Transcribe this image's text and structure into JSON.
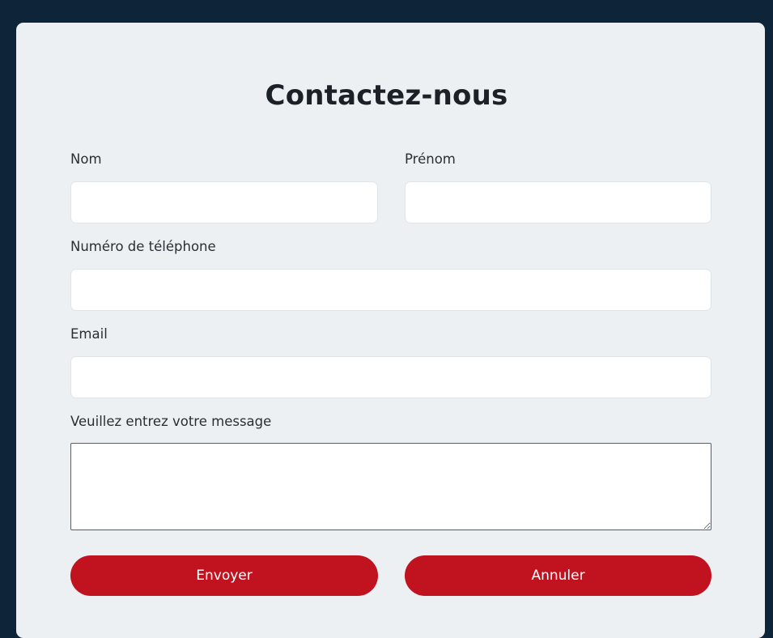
{
  "form": {
    "title": "Contactez-nous",
    "fields": {
      "nom": {
        "label": "Nom",
        "value": "",
        "placeholder": ""
      },
      "prenom": {
        "label": "Prénom",
        "value": "",
        "placeholder": ""
      },
      "telephone": {
        "label": "Numéro de téléphone",
        "value": "",
        "placeholder": ""
      },
      "email": {
        "label": "Email",
        "value": "",
        "placeholder": ""
      },
      "message": {
        "label": "Veuillez entrez votre message",
        "value": "",
        "placeholder": ""
      }
    },
    "buttons": {
      "submit": "Envoyer",
      "cancel": "Annuler"
    }
  },
  "colors": {
    "page_background": "#0e2438",
    "card_background": "#ecf0f3",
    "button_background": "#c0121f",
    "button_text": "#ffffff",
    "title_text": "#1c2128"
  }
}
